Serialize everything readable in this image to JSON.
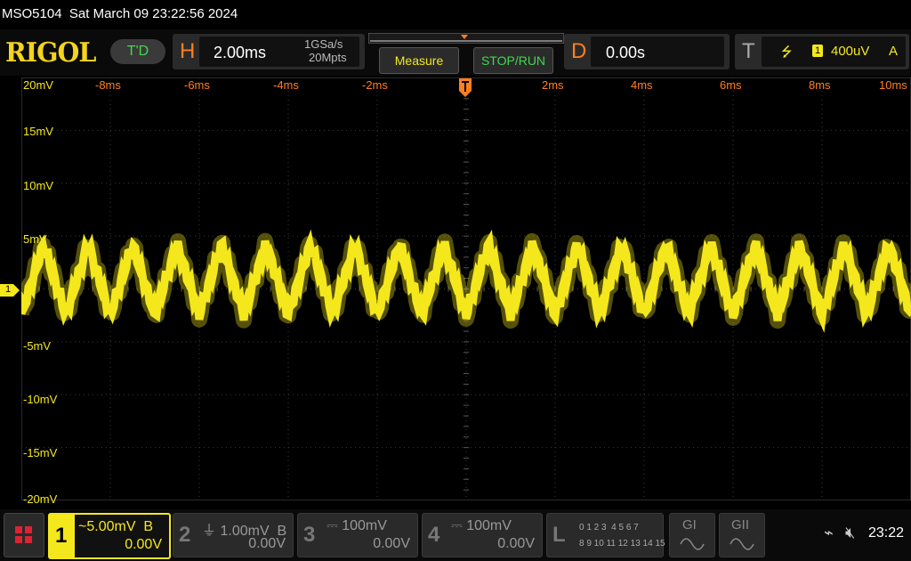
{
  "status": {
    "model": "MSO5104",
    "datetime": "Sat March 09 23:22:56 2024"
  },
  "logo": "RIGOL",
  "td_badge": "T'D",
  "horizontal": {
    "letter": "H",
    "timebase": "2.00ms",
    "sample_rate": "1GSa/s",
    "memory_depth": "20Mpts"
  },
  "buttons": {
    "measure": "Measure",
    "stop_run": "STOP/RUN"
  },
  "delay": {
    "letter": "D",
    "value": "0.00s"
  },
  "trigger": {
    "letter": "T",
    "channel_badge": "1",
    "level": "400uV",
    "mode": "A"
  },
  "x_ticks": [
    "-8ms",
    "-6ms",
    "-4ms",
    "-2ms",
    "2ms",
    "4ms",
    "6ms",
    "8ms",
    "10ms"
  ],
  "y_ticks": [
    "20mV",
    "15mV",
    "10mV",
    "5mV",
    "-5mV",
    "-10mV",
    "-15mV",
    "-20mV"
  ],
  "ch1_marker": "1",
  "channels": [
    {
      "num": "1",
      "scale": "5.00mV",
      "coupling_icon": "~",
      "bw": "B",
      "offset": "0.00V"
    },
    {
      "num": "2",
      "scale": "1.00mV",
      "coupling_icon": "⏚",
      "bw": "B",
      "offset": "0.00V"
    },
    {
      "num": "3",
      "scale": "100mV",
      "coupling_icon": "⎓",
      "bw": "",
      "offset": "0.00V"
    },
    {
      "num": "4",
      "scale": "100mV",
      "coupling_icon": "⎓",
      "bw": "",
      "offset": "0.00V"
    }
  ],
  "logic": {
    "letter": "L",
    "row1": "0 1 2 3  4 5 6 7",
    "row2": "8 9 10 11 12 13 14 15"
  },
  "generators": [
    "GI",
    "GII"
  ],
  "system": {
    "time": "23:22"
  },
  "colors": {
    "ch1": "#f4e81c",
    "accent": "#ff7f1e",
    "grid": "#3a3a3a"
  },
  "icons": [
    "usb-icon",
    "mute-icon",
    "grid-menu-icon"
  ]
}
